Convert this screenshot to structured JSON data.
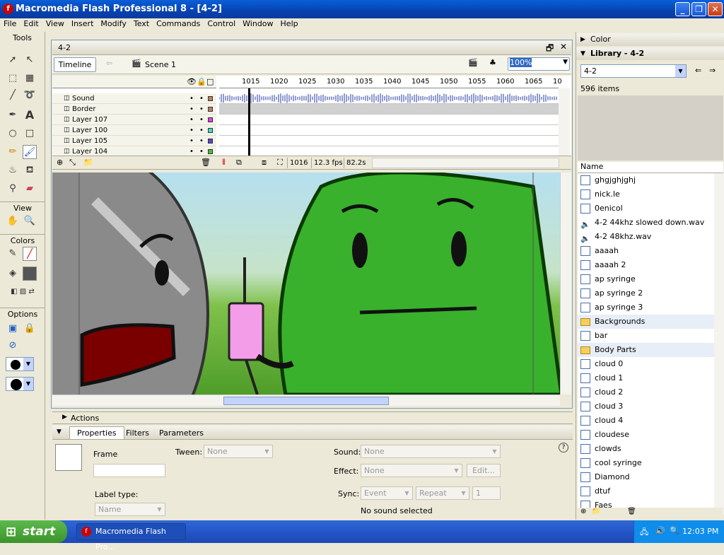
{
  "window": {
    "title": "Macromedia Flash Professional 8 - [4-2]"
  },
  "menu": [
    "File",
    "Edit",
    "View",
    "Insert",
    "Modify",
    "Text",
    "Commands",
    "Control",
    "Window",
    "Help"
  ],
  "tools": {
    "header": "Tools",
    "view_label": "View",
    "colors_label": "Colors",
    "options_label": "Options"
  },
  "document": {
    "tab": "4-2",
    "timeline_button": "Timeline",
    "scene": "Scene 1",
    "zoom": "100%"
  },
  "timeline": {
    "ruler_ticks": [
      "1015",
      "1020",
      "1025",
      "1030",
      "1035",
      "1040",
      "1045",
      "1050",
      "1055",
      "1060",
      "1065",
      "10"
    ],
    "layers": [
      {
        "name": "Sound",
        "color": "#c08060"
      },
      {
        "name": "Border",
        "color": "#c08060"
      },
      {
        "name": "Layer 107",
        "color": "#e040e0"
      },
      {
        "name": "Layer 100",
        "color": "#40e0c0"
      },
      {
        "name": "Layer 105",
        "color": "#6040e0"
      },
      {
        "name": "Layer 104",
        "color": "#40c040"
      }
    ],
    "current_frame": "1016",
    "fps": "12.3 fps",
    "elapsed": "82.2s"
  },
  "actions": {
    "label": "Actions"
  },
  "properties": {
    "tabs": [
      "Properties",
      "Filters",
      "Parameters"
    ],
    "frame_label": "Frame",
    "tween_label": "Tween:",
    "tween_value": "None",
    "label_type_label": "Label type:",
    "label_type_value": "Name",
    "sound_label": "Sound:",
    "sound_value": "None",
    "effect_label": "Effect:",
    "effect_value": "None",
    "edit_button": "Edit...",
    "sync_label": "Sync:",
    "sync_value": "Event",
    "repeat_value": "Repeat",
    "repeat_count": "1",
    "status": "No sound selected"
  },
  "panels": {
    "color": "Color",
    "library": "Library - 4-2",
    "library_select": "4-2",
    "item_count": "596 items",
    "name_column": "Name"
  },
  "library_items": [
    {
      "label": "ghgjghjghj",
      "type": "graphic"
    },
    {
      "label": "nick.le",
      "type": "graphic"
    },
    {
      "label": "0enicol",
      "type": "graphic"
    },
    {
      "label": "4-2 44khz slowed down.wav",
      "type": "sound"
    },
    {
      "label": "4-2 48khz.wav",
      "type": "sound"
    },
    {
      "label": "aaaah",
      "type": "graphic"
    },
    {
      "label": "aaaah 2",
      "type": "graphic"
    },
    {
      "label": "ap syringe",
      "type": "graphic"
    },
    {
      "label": "ap syringe 2",
      "type": "graphic"
    },
    {
      "label": "ap syringe 3",
      "type": "graphic"
    },
    {
      "label": "Backgrounds",
      "type": "folder"
    },
    {
      "label": "bar",
      "type": "graphic"
    },
    {
      "label": "Body Parts",
      "type": "folder"
    },
    {
      "label": "cloud 0",
      "type": "graphic"
    },
    {
      "label": "cloud 1",
      "type": "graphic"
    },
    {
      "label": "cloud 2",
      "type": "graphic"
    },
    {
      "label": "cloud 3",
      "type": "graphic"
    },
    {
      "label": "cloud 4",
      "type": "graphic"
    },
    {
      "label": "cloudese",
      "type": "graphic"
    },
    {
      "label": "clowds",
      "type": "graphic"
    },
    {
      "label": "cool syringe",
      "type": "graphic"
    },
    {
      "label": "Diamond",
      "type": "graphic"
    },
    {
      "label": "dtuf",
      "type": "graphic"
    },
    {
      "label": "Faes",
      "type": "graphic"
    }
  ],
  "taskbar": {
    "start": "start",
    "task": "Macromedia Flash Pro...",
    "clock": "12:03 PM"
  }
}
